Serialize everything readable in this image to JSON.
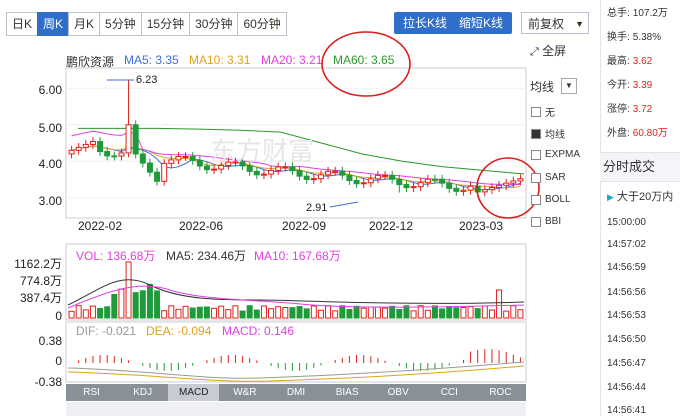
{
  "tabs": [
    {
      "label": "日K",
      "active": false
    },
    {
      "label": "周K",
      "active": true
    },
    {
      "label": "月K",
      "active": false
    },
    {
      "label": "5分钟",
      "active": false
    },
    {
      "label": "15分钟",
      "active": false
    },
    {
      "label": "30分钟",
      "active": false
    },
    {
      "label": "60分钟",
      "active": false
    }
  ],
  "actions": {
    "stretch": "拉长K线",
    "shrink": "缩短K线",
    "adjust": "前复权",
    "fullscreen": "全屏"
  },
  "stock_name": "鹏欣资源",
  "ma_legend": [
    {
      "label": "MA5: 3.35",
      "color": "#3a6fd6"
    },
    {
      "label": "MA10: 3.31",
      "color": "#e0a21a"
    },
    {
      "label": "MA20: 3.21",
      "color": "#e040e0"
    },
    {
      "label": "MA60: 3.65",
      "color": "#2a9a2a"
    }
  ],
  "indicator_select": "均线",
  "indicator_options": [
    {
      "label": "无",
      "checked": false
    },
    {
      "label": "均线",
      "checked": true
    },
    {
      "label": "EXPMA",
      "checked": false
    },
    {
      "label": "SAR",
      "checked": false
    },
    {
      "label": "BOLL",
      "checked": false
    },
    {
      "label": "BBI",
      "checked": false
    }
  ],
  "chart_data": {
    "type": "candlestick",
    "x_ticks": [
      "2022-02",
      "2022-06",
      "2022-09",
      "2022-12",
      "2023-03"
    ],
    "y_ticks": [
      "6.00",
      "5.00",
      "4.00",
      "3.00"
    ],
    "ylim": [
      2.5,
      6.5
    ],
    "annotations": [
      "6.23",
      "2.91"
    ],
    "ma60_values": [
      4.9,
      4.9,
      4.9,
      4.88,
      4.85,
      4.8,
      4.5,
      4.2,
      4.0,
      3.85,
      3.75,
      3.65
    ],
    "volume_legend": [
      {
        "label": "VOL: 136.68万",
        "color": "#e040e0"
      },
      {
        "label": "MA5: 234.46万",
        "color": "#333333"
      },
      {
        "label": "MA10: 167.68万",
        "color": "#e040e0"
      }
    ],
    "volume_ticks": [
      "1162.2万",
      "774.8万",
      "387.4万",
      "0"
    ],
    "macd_legend": [
      {
        "label": "DIF: -0.021",
        "color": "#999999"
      },
      {
        "label": "DEA: -0.094",
        "color": "#e0a21a"
      },
      {
        "label": "MACD: 0.146",
        "color": "#e040e0"
      }
    ],
    "macd_ticks": [
      "0.38",
      "0",
      "-0.38"
    ]
  },
  "watermark": "东方财富",
  "bottom_tabs": [
    "RSI",
    "KDJ",
    "MACD",
    "W&R",
    "DMI",
    "BIAS",
    "OBV",
    "CCI",
    "ROC"
  ],
  "bottom_active": "MACD",
  "summary": [
    {
      "label": "总手:",
      "value": "107.2万",
      "color": "#333333"
    },
    {
      "label": "换手:",
      "value": "5.38%",
      "color": "#333333"
    },
    {
      "label": "最高:",
      "value": "3.62",
      "color": "#e0201a"
    },
    {
      "label": "今开:",
      "value": "3.39",
      "color": "#e0201a"
    },
    {
      "label": "涨停:",
      "value": "3.72",
      "color": "#e0201a"
    },
    {
      "label": "外盘:",
      "value": "60.80万",
      "color": "#e0201a"
    }
  ],
  "trade_section": "分时成交",
  "trade_filter": "大于20万内",
  "trade_times": [
    "15:00:00",
    "14:57:02",
    "14:56:59",
    "14:56:56",
    "14:56:53",
    "14:56:50",
    "14:56:47",
    "14:56:44",
    "14:56:41"
  ]
}
